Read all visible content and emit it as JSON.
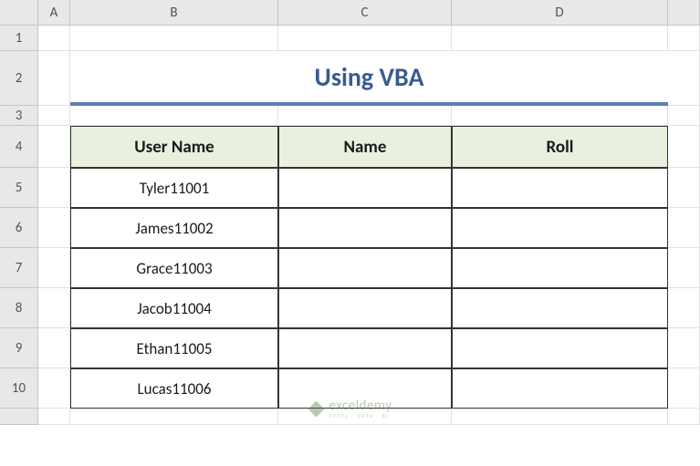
{
  "columns": [
    "",
    "A",
    "B",
    "C",
    "D",
    ""
  ],
  "rows": [
    "1",
    "2",
    "3",
    "4",
    "5",
    "6",
    "7",
    "8",
    "9",
    "10",
    ""
  ],
  "title": "Using VBA",
  "table": {
    "headers": [
      "User Name",
      "Name",
      "Roll"
    ],
    "data": [
      {
        "userName": "Tyler11001",
        "name": "",
        "roll": ""
      },
      {
        "userName": "James11002",
        "name": "",
        "roll": ""
      },
      {
        "userName": "Grace11003",
        "name": "",
        "roll": ""
      },
      {
        "userName": "Jacob11004",
        "name": "",
        "roll": ""
      },
      {
        "userName": "Ethan11005",
        "name": "",
        "roll": ""
      },
      {
        "userName": "Lucas11006",
        "name": "",
        "roll": ""
      }
    ]
  },
  "watermark": {
    "main": "exceldemy",
    "sub": "EXCEL · DATA · BI"
  },
  "chart_data": {
    "type": "table",
    "title": "Using VBA",
    "headers": [
      "User Name",
      "Name",
      "Roll"
    ],
    "rows": [
      [
        "Tyler11001",
        "",
        ""
      ],
      [
        "James11002",
        "",
        ""
      ],
      [
        "Grace11003",
        "",
        ""
      ],
      [
        "Jacob11004",
        "",
        ""
      ],
      [
        "Ethan11005",
        "",
        ""
      ],
      [
        "Lucas11006",
        "",
        ""
      ]
    ]
  }
}
